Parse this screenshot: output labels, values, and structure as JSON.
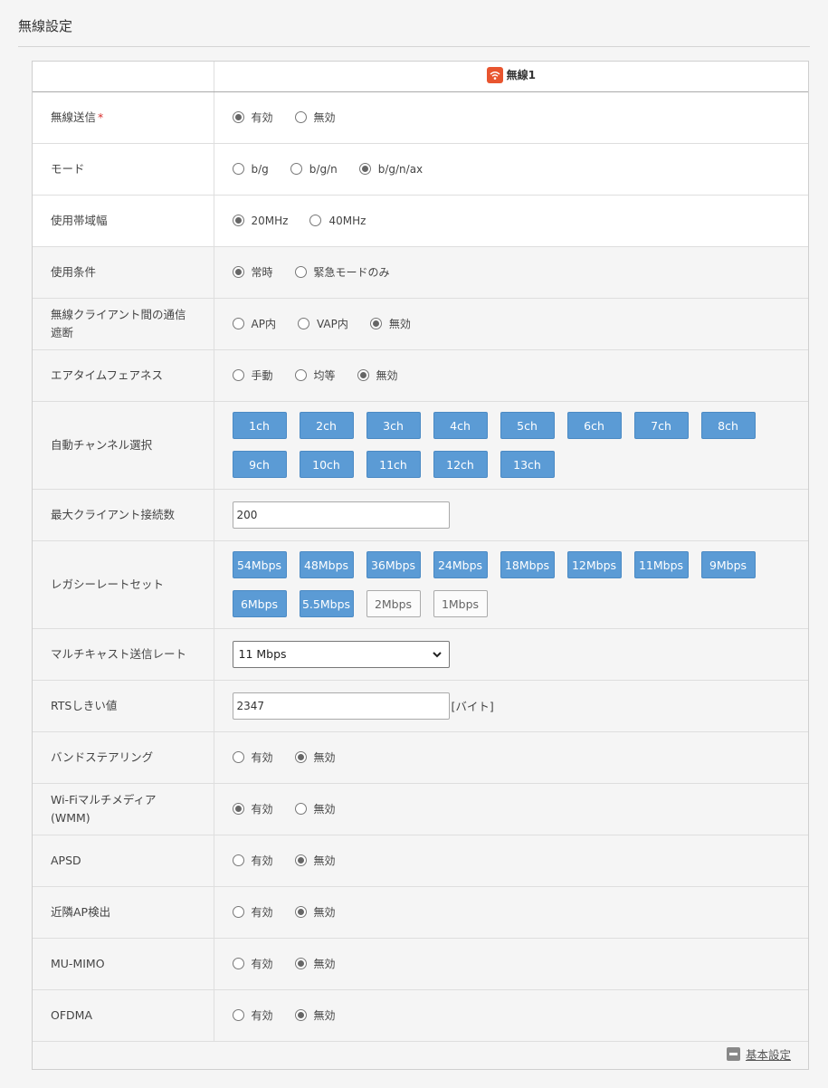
{
  "page": {
    "title": "無線設定"
  },
  "table": {
    "header_label": "無線1"
  },
  "rows": {
    "tx": {
      "label": "無線送信",
      "required_mark": "*",
      "options": [
        "有効",
        "無効"
      ],
      "selected": 0
    },
    "mode": {
      "label": "モード",
      "options": [
        "b/g",
        "b/g/n",
        "b/g/n/ax"
      ],
      "selected": 2
    },
    "bandwidth": {
      "label": "使用帯域幅",
      "options": [
        "20MHz",
        "40MHz"
      ],
      "selected": 0
    },
    "condition": {
      "label": "使用条件",
      "options": [
        "常時",
        "緊急モードのみ"
      ],
      "selected": 0
    },
    "isolation": {
      "label_line1": "無線クライアント間の通信",
      "label_line2": "遮断",
      "options": [
        "AP内",
        "VAP内",
        "無効"
      ],
      "selected": 2
    },
    "airtime": {
      "label": "エアタイムフェアネス",
      "options": [
        "手動",
        "均等",
        "無効"
      ],
      "selected": 2
    },
    "channels": {
      "label": "自動チャンネル選択",
      "buttons": [
        "1ch",
        "2ch",
        "3ch",
        "4ch",
        "5ch",
        "6ch",
        "7ch",
        "8ch",
        "9ch",
        "10ch",
        "11ch",
        "12ch",
        "13ch"
      ]
    },
    "max_clients": {
      "label": "最大クライアント接続数",
      "value": "200"
    },
    "legacy": {
      "label": "レガシーレートセット",
      "buttons": [
        {
          "text": "54Mbps",
          "active": true
        },
        {
          "text": "48Mbps",
          "active": true
        },
        {
          "text": "36Mbps",
          "active": true
        },
        {
          "text": "24Mbps",
          "active": true
        },
        {
          "text": "18Mbps",
          "active": true
        },
        {
          "text": "12Mbps",
          "active": true
        },
        {
          "text": "11Mbps",
          "active": true
        },
        {
          "text": "9Mbps",
          "active": true
        },
        {
          "text": "6Mbps",
          "active": true
        },
        {
          "text": "5.5Mbps",
          "active": true
        },
        {
          "text": "2Mbps",
          "active": false
        },
        {
          "text": "1Mbps",
          "active": false
        }
      ]
    },
    "multicast": {
      "label": "マルチキャスト送信レート",
      "selected": "11 Mbps"
    },
    "rts": {
      "label": "RTSしきい値",
      "value": "2347",
      "unit": "[バイト]"
    },
    "band_steering": {
      "label": "バンドステアリング",
      "options": [
        "有効",
        "無効"
      ],
      "selected": 1
    },
    "wmm": {
      "label_line1": "Wi-Fiマルチメディア",
      "label_line2": "(WMM)",
      "options": [
        "有効",
        "無効"
      ],
      "selected": 0
    },
    "apsd": {
      "label": "APSD",
      "options": [
        "有効",
        "無効"
      ],
      "selected": 1
    },
    "neighbor": {
      "label": "近隣AP検出",
      "options": [
        "有効",
        "無効"
      ],
      "selected": 1
    },
    "mumimo": {
      "label": "MU-MIMO",
      "options": [
        "有効",
        "無効"
      ],
      "selected": 1
    },
    "ofdma": {
      "label": "OFDMA",
      "options": [
        "有効",
        "無効"
      ],
      "selected": 1
    }
  },
  "footer": {
    "link": "基本設定"
  },
  "icons": {
    "header": "wifi-icon",
    "footer": "minus-icon"
  },
  "colors": {
    "button_active": "#5b9bd5",
    "wifi_badge": "#e8552f",
    "required": "#d9302f"
  }
}
